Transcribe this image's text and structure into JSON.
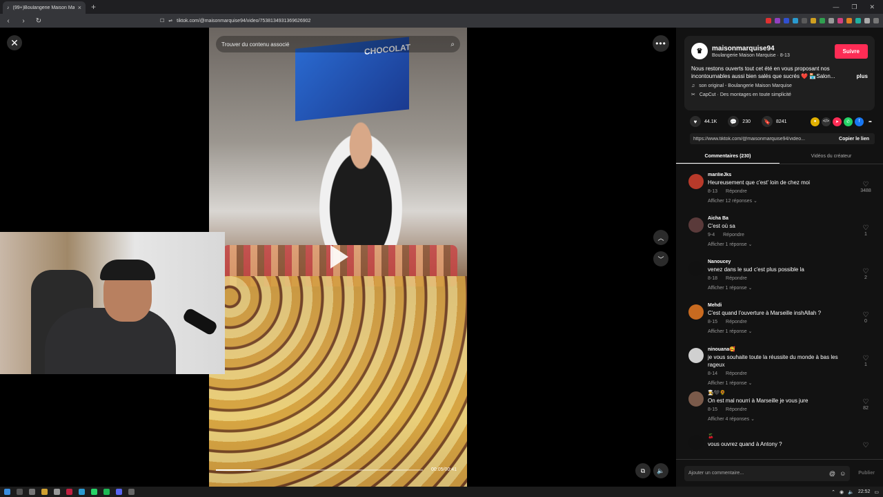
{
  "browser": {
    "tab_title": "(99+)Boulangerie Maison Marq...",
    "tab_close": "×",
    "new_tab": "+",
    "url": "tiktok.com/@maisonmarquise94/video/7538134931369626902",
    "window_controls": [
      "—",
      "❐",
      "✕"
    ]
  },
  "video": {
    "search_placeholder": "Trouver du contenu associé",
    "screen_text": "CHOCOLAT",
    "time": "00:05/00:41",
    "progress_fraction": 0.17
  },
  "creator": {
    "username": "maisonmarquise94",
    "subtitle": "Boulangerie Maison Marquise · 8-13",
    "follow_label": "Suivre",
    "description": "Nous restons ouverts tout cet été en vous proposant nos incontournables aussi bien salés que sucrés ❤️ 🏪Salon...",
    "more_label": "plus",
    "music": "son original - Boulangerie Maison Marquise",
    "capcut": "CapCut · Des montages en toute simplicité"
  },
  "stats": {
    "likes": "44.1K",
    "comments": "230",
    "saves": "8241"
  },
  "link": {
    "url": "https://www.tiktok.com/@maisonmarquise94/video...",
    "copy_label": "Copier le lien"
  },
  "tabs": {
    "comments": "Commentaires (230)",
    "creator_videos": "Vidéos du créateur"
  },
  "comments": [
    {
      "user": "marilieJks",
      "text": "Heureusement que c'est' loin de chez moi",
      "date": "8-13",
      "reply": "Répondre",
      "replies": "Afficher 12 réponses ⌄",
      "likes": "3488",
      "avatar_color": "#b83a2a"
    },
    {
      "user": "Aicha Ba",
      "text": "C'est où sa",
      "date": "9-4",
      "reply": "Répondre",
      "replies": "Afficher 1 réponse ⌄",
      "likes": "1",
      "avatar_color": "#5a3a3a"
    },
    {
      "user": "Nanoucey",
      "text": "venez dans le sud c'est plus possible la",
      "date": "8-18",
      "reply": "Répondre",
      "replies": "Afficher 1 réponse ⌄",
      "likes": "2",
      "avatar_color": "#111111"
    },
    {
      "user": "Mehdi",
      "text": "C'est quand l'ouverture à Marseille inshAllah ?",
      "date": "8-15",
      "reply": "Répondre",
      "replies": "Afficher 1 réponse ⌄",
      "likes": "0",
      "avatar_color": "#c86a20"
    },
    {
      "user": "ninouana🥰",
      "text": "je vous souhaite toute la réussite du monde à bas les rageux",
      "date": "8-14",
      "reply": "Répondre",
      "replies": "Afficher 1 réponse ⌄",
      "likes": "1",
      "avatar_color": "#d0d0d0"
    },
    {
      "user": "👩‍🍳🖤🌻",
      "text": "On est mal nourri à Marseille je vous jure",
      "date": "8-15",
      "reply": "Répondre",
      "replies": "Afficher 4 réponses ⌄",
      "likes": "82",
      "avatar_color": "#7a5a4a"
    },
    {
      "user": "🍒",
      "text": "vous ouvrez quand à Antony ?",
      "date": "",
      "reply": "",
      "replies": "",
      "likes": "",
      "avatar_color": "#111111"
    }
  ],
  "comment_input": {
    "placeholder": "Ajouter un commentaire...",
    "at": "@",
    "emoji": "☺",
    "publish": "Publier"
  },
  "taskbar": {
    "time": "22:52"
  },
  "colors": {
    "accent": "#fe2c55",
    "sidebar_bg": "#121212"
  }
}
